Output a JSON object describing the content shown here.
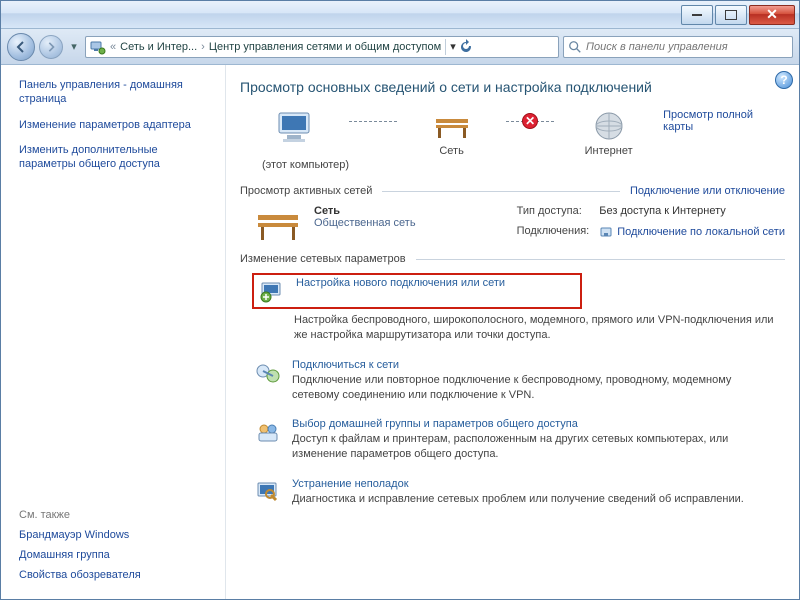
{
  "window": {
    "address_segments": [
      "Сеть и Интер...",
      "Центр управления сетями и общим доступом"
    ],
    "search_placeholder": "Поиск в панели управления"
  },
  "sidebar": {
    "items": [
      {
        "label": "Панель управления - домашняя страница"
      },
      {
        "label": "Изменение параметров адаптера"
      },
      {
        "label": "Изменить дополнительные параметры общего доступа"
      }
    ],
    "see_also_label": "См. также",
    "see_also_items": [
      {
        "label": "Брандмауэр Windows"
      },
      {
        "label": "Домашняя группа"
      },
      {
        "label": "Свойства обозревателя"
      }
    ]
  },
  "main": {
    "title": "Просмотр основных сведений о сети и настройка подключений",
    "netmap": {
      "this_pc_note": "(этот компьютер)",
      "node_network": "Сеть",
      "node_internet": "Интернет",
      "map_link": "Просмотр полной карты"
    },
    "sections": {
      "active_networks": "Просмотр активных сетей",
      "active_networks_link": "Подключение или отключение",
      "change_settings": "Изменение сетевых параметров"
    },
    "active": {
      "name": "Сеть",
      "type": "Общественная сеть",
      "access_type_label": "Тип доступа:",
      "access_type_value": "Без доступа к Интернету",
      "connections_label": "Подключения:",
      "connections_value": "Подключение по локальной сети"
    },
    "tasks": [
      {
        "title": "Настройка нового подключения или сети",
        "desc": "Настройка беспроводного, широкополосного, модемного, прямого или VPN-подключения или же настройка маршрутизатора или точки доступа.",
        "highlight": true
      },
      {
        "title": "Подключиться к сети",
        "desc": "Подключение или повторное подключение к беспроводному, проводному, модемному сетевому соединению или подключение к VPN."
      },
      {
        "title": "Выбор домашней группы и параметров общего доступа",
        "desc": "Доступ к файлам и принтерам, расположенным на других сетевых компьютерах, или изменение параметров общего доступа."
      },
      {
        "title": "Устранение неполадок",
        "desc": "Диагностика и исправление сетевых проблем или получение сведений об исправлении."
      }
    ]
  }
}
